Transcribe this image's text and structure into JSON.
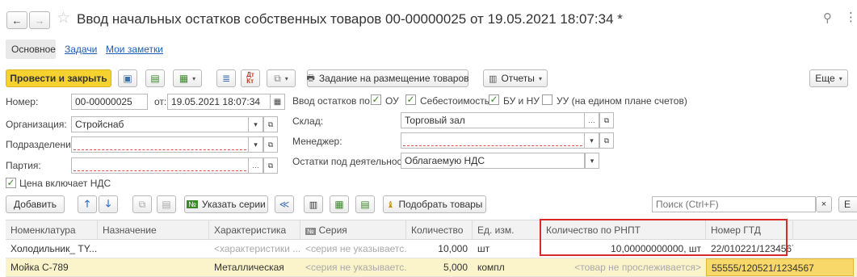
{
  "title_bar": {
    "title": "Ввод начальных остатков собственных товаров 00-00000025 от 19.05.2021 18:07:34 *"
  },
  "tabs": [
    "Основное",
    "Задачи",
    "Мои заметки"
  ],
  "toolbar": {
    "post_close": "Провести и закрыть",
    "placement_task": "Задание на размещение товаров",
    "reports": "Отчеты",
    "more": "Еще"
  },
  "header": {
    "number_label": "Номер:",
    "number_value": "00-00000025",
    "date_label": "от:",
    "date_value": "19.05.2021 18:07:34",
    "org_label": "Организация:",
    "org_value": "Стройснаб",
    "dept_label": "Подразделение:",
    "dept_value": "",
    "batch_label": "Партия:",
    "batch_value": "",
    "vat_label": "Цена включает НДС",
    "input_label": "Ввод остатков по:",
    "flags": [
      "ОУ",
      "Себестоимость",
      "БУ и НУ",
      "УУ (на едином плане счетов)"
    ],
    "warehouse_label": "Склад:",
    "warehouse_value": "Торговый зал",
    "manager_label": "Менеджер:",
    "manager_value": "",
    "activity_label": "Остатки под деятельность:",
    "activity_value": "Облагаемую НДС"
  },
  "table_toolbar": {
    "add": "Добавить",
    "specify_series": "Указать серии",
    "pick_goods": "Подобрать товары",
    "search_placeholder": "Поиск (Ctrl+F)"
  },
  "columns": [
    "Номенклатура",
    "Назначение",
    "Характеристика",
    "Серия",
    "Количество",
    "Ед. изм.",
    "Количество по РНПТ",
    "Номер ГТД"
  ],
  "rows": [
    {
      "item": "Холодильник_ TY...",
      "purpose": "",
      "characteristic": "<характеристики ...",
      "series": "<серия не указываетс...",
      "qty": "10,000",
      "unit": "шт",
      "rnpt_qty": "10,00000000000, шт",
      "gtd": "22/010221/1234567"
    },
    {
      "item": "Мойка С-789",
      "purpose": "",
      "characteristic": "Металлическая",
      "series": "<серия не указываетс...",
      "qty": "5,000",
      "unit": "компл",
      "rnpt_qty": "<товар не прослеживается>",
      "gtd": "55555/120521/1234567"
    }
  ],
  "colors": {
    "primary_button": "#f6d231",
    "selected_row": "#fbf3c9",
    "highlight_frame": "#d9292b",
    "link": "#1a5fb4"
  }
}
